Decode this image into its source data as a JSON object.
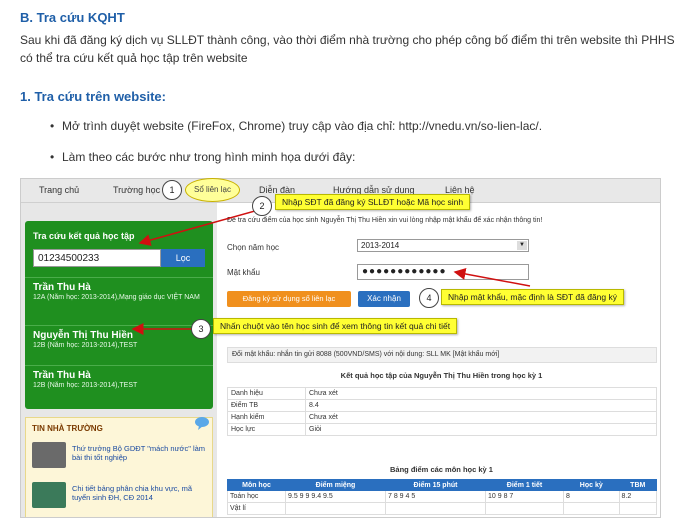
{
  "doc": {
    "heading": "B. Tra cứu KQHT",
    "para": "Sau khi đã đăng ký dịch vụ SLLĐT thành công, vào thời điểm nhà trường cho phép công bố điểm thi trên website thì PHHS có thể tra cứu kết quả học tập trên website",
    "subheading": "1. Tra cứu trên website:",
    "bullet1": "Mở trình duyệt website (FireFox, Chrome) truy cập vào địa chỉ: http://vnedu.vn/so-lien-lac/.",
    "bullet2": "Làm theo các bước như trong hình minh họa dưới đây:"
  },
  "nav": [
    "Trang chủ",
    "Trường học",
    "Sổ liên lạc",
    "Diễn đàn",
    "Hướng dẫn sử dụng",
    "Liên hệ"
  ],
  "sidebar": {
    "lookup_label": "Tra cứu kết quả học tập",
    "phone_value": "01234500233",
    "lookup_btn": "Lọc",
    "students": [
      {
        "name": "Trần Thu Hà",
        "detail": "12A (Năm học: 2013-2014),Mạng giáo dục VIỆT NAM"
      },
      {
        "name": "Nguyễn Thị Thu Hiền",
        "detail": "12B (Năm học: 2013-2014),TEST"
      },
      {
        "name": "Trần Thu Hà",
        "detail": "12B (Năm học: 2013-2014),TEST"
      }
    ],
    "news_title": "TIN NHÀ TRƯỜNG",
    "news": [
      "Thứ trưởng Bộ GDĐT \"mách nước\" làm bài thi tốt nghiệp",
      "Chi tiết bảng phân chia khu vực, mã tuyển sinh ĐH, CĐ 2014"
    ]
  },
  "content": {
    "intro": "Để tra cứu điểm của học sinh Nguyễn Thị Thu Hiền xin vui lòng nhập mật khẩu để xác nhận thông tin!",
    "year_label": "Chọn năm học",
    "year_value": "2013-2014",
    "pwd_label": "Mật khẩu",
    "pwd_value": "●●●●●●●●●●●●",
    "register_btn": "Đăng ký sử dụng sổ liên lạc",
    "confirm_btn": "Xác nhận",
    "notice": "Đổi mật khẩu: nhắn tin gửi 8088 (500VND/SMS) với nội dung: SLL MK [Mật khẩu mới]",
    "result_title": "Kết quả học tập của Nguyễn Thị Thu Hiền trong học kỳ 1",
    "result_rows": [
      [
        "Danh hiệu",
        "Chưa xét"
      ],
      [
        "Điểm TB",
        "8.4"
      ],
      [
        "Hạnh kiểm",
        "Chưa xét"
      ],
      [
        "Học lực",
        "Giỏi"
      ]
    ],
    "score_title": "Bảng điểm các môn học kỳ 1",
    "score_headers": [
      "Môn học",
      "Điểm miệng",
      "Điểm 15 phút",
      "Điểm 1 tiết",
      "Học kỳ",
      "TBM"
    ],
    "score_rows": [
      [
        "Toán học",
        "9.5  9  9  9.4  9.5",
        "7  8  9  4  5",
        "10  9  8  7",
        "8",
        "8.2"
      ],
      [
        "Vật lí",
        "",
        "",
        "",
        "",
        ""
      ]
    ]
  },
  "callouts": {
    "c1": "1",
    "c1_label": "Sổ liên lạc",
    "c2": "2",
    "c2_text": "Nhập SĐT đã đăng ký SLLĐT hoặc Mã học sinh",
    "c3": "3",
    "c3_text": "Nhấn chuột vào tên học sinh để xem thông tin kết quả chi tiết",
    "c4": "4",
    "c4_text": "Nhập mật khẩu, mặc định là SĐT đã đăng ký"
  },
  "colors": {
    "accent": "#1f5fa8",
    "sidebar_green": "#1f8f1f",
    "button_blue": "#2a6fbf",
    "button_orange": "#f0901e",
    "callout_yellow": "#ffff33",
    "arrow_red": "#d01010"
  }
}
